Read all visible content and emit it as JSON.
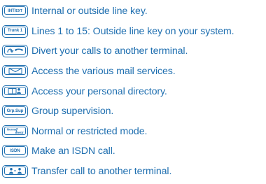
{
  "accent_color": "#1f6fb0",
  "keys": [
    {
      "key_label": "INT/EXT",
      "icon": "int-ext-key-icon",
      "description": "Internal or outside line key."
    },
    {
      "key_label": "Trunk 1",
      "icon": "trunk-key-icon",
      "description": "Lines 1 to 15: Outside line key on your system."
    },
    {
      "key_label": "",
      "icon": "divert-calls-key-icon",
      "description": "Divert your calls to another terminal."
    },
    {
      "key_label": "",
      "icon": "mail-envelope-key-icon",
      "description": "Access the various mail services."
    },
    {
      "key_label": "",
      "icon": "personal-directory-key-icon",
      "description": "Access your personal directory."
    },
    {
      "key_label": "Grp.Sup",
      "icon": "group-supervision-key-icon",
      "description": "Group supervision."
    },
    {
      "key_label": "Normal/Restr",
      "icon": "normal-restricted-key-icon",
      "description": "Normal or restricted mode."
    },
    {
      "key_label": "ISDN",
      "icon": "isdn-key-icon",
      "description": "Make an ISDN call."
    },
    {
      "key_label": "",
      "icon": "transfer-call-key-icon",
      "description": "Transfer call to another terminal."
    }
  ]
}
